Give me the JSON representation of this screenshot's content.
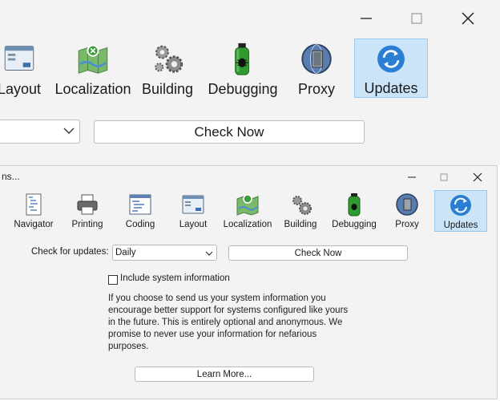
{
  "back_window": {
    "toolbar": [
      {
        "id": "layout",
        "label": "Layout",
        "icon": "layout-icon"
      },
      {
        "id": "localization",
        "label": "Localization",
        "icon": "map-icon"
      },
      {
        "id": "building",
        "label": "Building",
        "icon": "gears-icon"
      },
      {
        "id": "debugging",
        "label": "Debugging",
        "icon": "bug-spray-icon"
      },
      {
        "id": "proxy",
        "label": "Proxy",
        "icon": "proxy-icon"
      },
      {
        "id": "updates",
        "label": "Updates",
        "icon": "refresh-icon",
        "selected": true
      }
    ],
    "check_now_label": "Check Now"
  },
  "dialog": {
    "title": "ns...",
    "toolbar": [
      {
        "id": "navigator",
        "label": "Navigator",
        "icon": "navigator-icon"
      },
      {
        "id": "printing",
        "label": "Printing",
        "icon": "printer-icon"
      },
      {
        "id": "coding",
        "label": "Coding",
        "icon": "code-icon"
      },
      {
        "id": "layout",
        "label": "Layout",
        "icon": "layout-icon"
      },
      {
        "id": "localization",
        "label": "Localization",
        "icon": "map-icon"
      },
      {
        "id": "building",
        "label": "Building",
        "icon": "gears-icon"
      },
      {
        "id": "debugging",
        "label": "Debugging",
        "icon": "bug-spray-icon"
      },
      {
        "id": "proxy",
        "label": "Proxy",
        "icon": "proxy-icon"
      },
      {
        "id": "updates",
        "label": "Updates",
        "icon": "refresh-icon",
        "selected": true
      }
    ],
    "check_for_updates_label": "Check for updates:",
    "frequency_value": "Daily",
    "check_now_label": "Check Now",
    "include_system_info_label": "Include system information",
    "include_system_info_checked": false,
    "info_text": "If you choose to send us your system information you encourage better support for systems configured like yours in the future. This is entirely optional and anonymous. We promise to never use your information for nefarious purposes.",
    "learn_more_label": "Learn More..."
  },
  "colors": {
    "selected_bg": "#cce4f7",
    "selected_border": "#99c9ef",
    "window_bg": "#f3f3f3"
  }
}
